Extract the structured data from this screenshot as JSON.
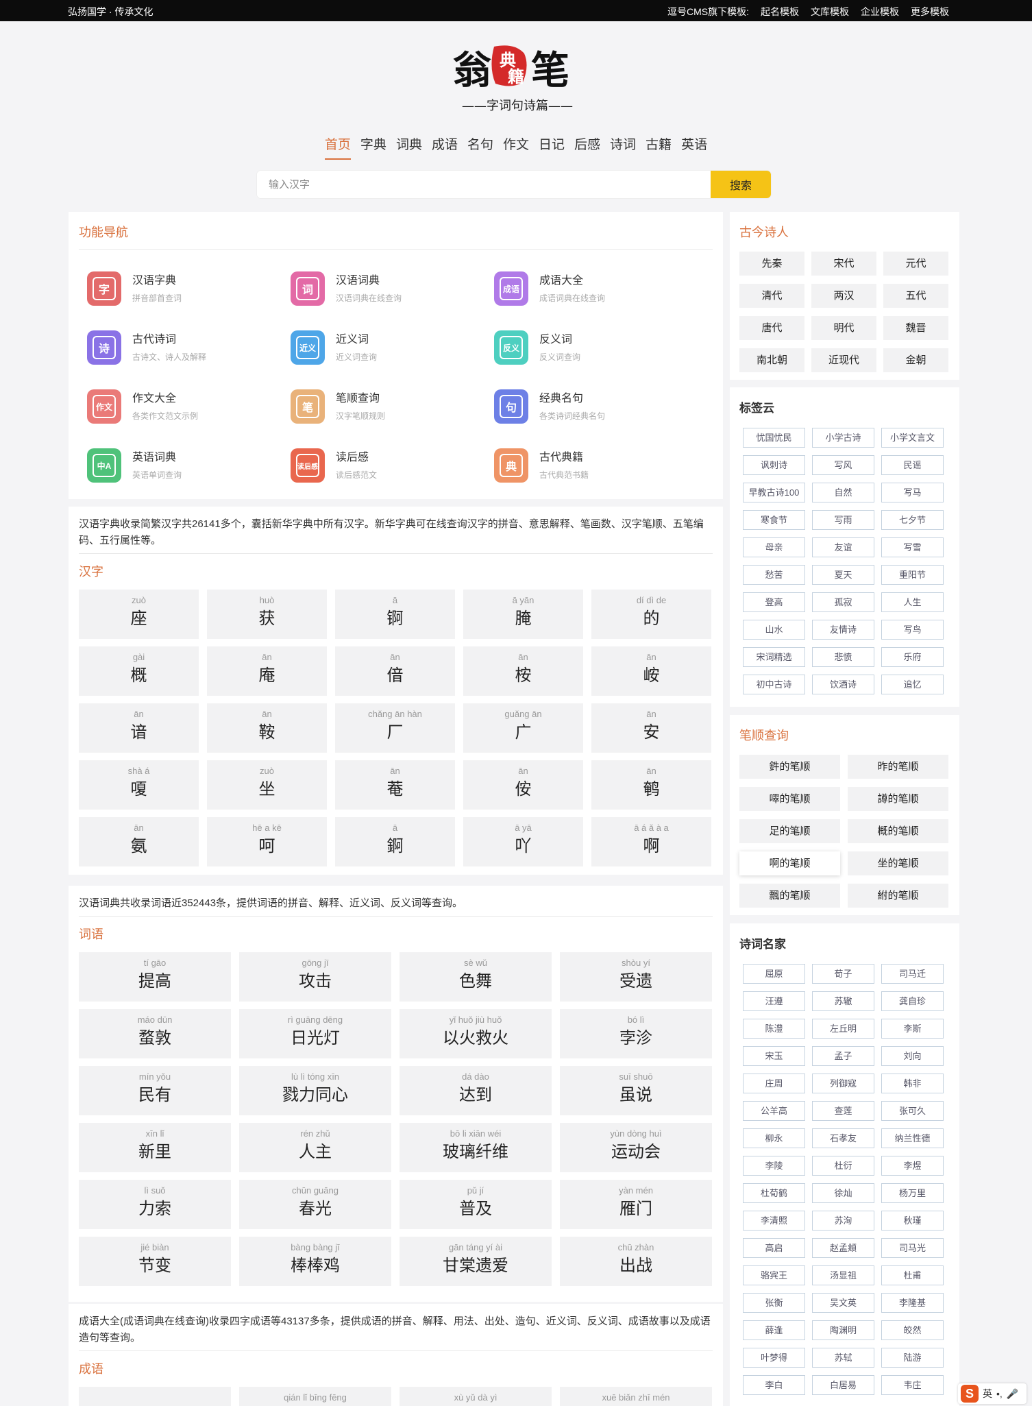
{
  "topbar": {
    "left": "弘扬国学 · 传承文化",
    "prefix": "逗号CMS旗下模板:",
    "links": [
      "起名模板",
      "文库模板",
      "企业模板",
      "更多模板"
    ]
  },
  "logo": {
    "chars": [
      "翁",
      "典",
      "籍",
      "笔"
    ],
    "tagline": "——字词句诗篇——"
  },
  "nav": [
    "首页",
    "字典",
    "词典",
    "成语",
    "名句",
    "作文",
    "日记",
    "后感",
    "诗词",
    "古籍",
    "英语"
  ],
  "search": {
    "placeholder": "输入汉字",
    "button": "搜索"
  },
  "func": {
    "title": "功能导航",
    "items": [
      {
        "icon": "字",
        "name": "汉语字典",
        "desc": "拼音部首查词",
        "color": "#e36a6a"
      },
      {
        "icon": "词",
        "name": "汉语词典",
        "desc": "汉语词典在线查询",
        "color": "#e36aa6"
      },
      {
        "icon": "成语",
        "name": "成语大全",
        "desc": "成语词典在线查询",
        "color": "#b07ae8"
      },
      {
        "icon": "诗",
        "name": "古代诗词",
        "desc": "古诗文、诗人及解释",
        "color": "#8a72e6"
      },
      {
        "icon": "近义",
        "name": "近义词",
        "desc": "近义词查询",
        "color": "#4ea6e8"
      },
      {
        "icon": "反义",
        "name": "反义词",
        "desc": "反义词查询",
        "color": "#4ecfc0"
      },
      {
        "icon": "作文",
        "name": "作文大全",
        "desc": "各类作文范文示例",
        "color": "#ea7a78"
      },
      {
        "icon": "笔",
        "name": "笔顺查询",
        "desc": "汉字笔顺规则",
        "color": "#e9b27a"
      },
      {
        "icon": "句",
        "name": "经典名句",
        "desc": "各类诗词经典名句",
        "color": "#6d80e6"
      },
      {
        "icon": "中A",
        "name": "英语词典",
        "desc": "英语单词查询",
        "color": "#4fc27a"
      },
      {
        "icon": "读后感",
        "name": "读后感",
        "desc": "读后感范文",
        "color": "#e9674e"
      },
      {
        "icon": "典",
        "name": "古代典籍",
        "desc": "古代典范书籍",
        "color": "#ef9466"
      }
    ]
  },
  "hanzi": {
    "desc": "汉语字典收录简繁汉字共26141多个，囊括新华字典中所有汉字。新华字典可在线查询汉字的拼音、意思解释、笔画数、汉字笔顺、五笔编码、五行属性等。",
    "title": "汉字",
    "items": [
      {
        "py": "zuò",
        "ch": "座"
      },
      {
        "py": "huò",
        "ch": "获"
      },
      {
        "py": "ā",
        "ch": "锕"
      },
      {
        "py": "ā yān",
        "ch": "腌"
      },
      {
        "py": "dí dì de",
        "ch": "的"
      },
      {
        "py": "gài",
        "ch": "概"
      },
      {
        "py": "ān",
        "ch": "庵"
      },
      {
        "py": "ān",
        "ch": "偣"
      },
      {
        "py": "ān",
        "ch": "桉"
      },
      {
        "py": "ān",
        "ch": "峖"
      },
      {
        "py": "ān",
        "ch": "谙"
      },
      {
        "py": "ān",
        "ch": "鞍"
      },
      {
        "py": "chǎng ān hàn",
        "ch": "厂"
      },
      {
        "py": "guǎng ān",
        "ch": "广"
      },
      {
        "py": "ān",
        "ch": "安"
      },
      {
        "py": "shà á",
        "ch": "嗄"
      },
      {
        "py": "zuò",
        "ch": "坐"
      },
      {
        "py": "ān",
        "ch": "菴"
      },
      {
        "py": "ān",
        "ch": "侒"
      },
      {
        "py": "ān",
        "ch": "鹌"
      },
      {
        "py": "ān",
        "ch": "氨"
      },
      {
        "py": "hē a kē",
        "ch": "呵"
      },
      {
        "py": "ā",
        "ch": "錒"
      },
      {
        "py": "ā yā",
        "ch": "吖"
      },
      {
        "py": "ā á ǎ à a",
        "ch": "啊"
      }
    ]
  },
  "ciyu": {
    "desc": "汉语词典共收录词语近352443条，提供词语的拼音、解释、近义词、反义词等查询。",
    "title": "词语",
    "items": [
      {
        "py": "tí gāo",
        "ch": "提高"
      },
      {
        "py": "gōng jī",
        "ch": "攻击"
      },
      {
        "py": "sè wǔ",
        "ch": "色舞"
      },
      {
        "py": "shòu yí",
        "ch": "受遗"
      },
      {
        "py": "máo dūn",
        "ch": "蝥敦"
      },
      {
        "py": "rì guāng dēng",
        "ch": "日光灯"
      },
      {
        "py": "yǐ huǒ jiù huǒ",
        "ch": "以火救火"
      },
      {
        "py": "bó lì",
        "ch": "孛沴"
      },
      {
        "py": "mín yǒu",
        "ch": "民有"
      },
      {
        "py": "lù lì tóng xīn",
        "ch": "戮力同心"
      },
      {
        "py": "dá dào",
        "ch": "达到"
      },
      {
        "py": "suī shuō",
        "ch": "虽说"
      },
      {
        "py": "xīn lǐ",
        "ch": "新里"
      },
      {
        "py": "rén zhǔ",
        "ch": "人主"
      },
      {
        "py": "bō li xiān wéi",
        "ch": "玻璃纤维"
      },
      {
        "py": "yùn dòng huì",
        "ch": "运动会"
      },
      {
        "py": "lì suǒ",
        "ch": "力索"
      },
      {
        "py": "chūn guāng",
        "ch": "春光"
      },
      {
        "py": "pǔ jí",
        "ch": "普及"
      },
      {
        "py": "yàn mén",
        "ch": "雁门"
      },
      {
        "py": "jié biàn",
        "ch": "节变"
      },
      {
        "py": "bàng bàng jī",
        "ch": "棒棒鸡"
      },
      {
        "py": "gān táng yí ài",
        "ch": "甘棠遗爱"
      },
      {
        "py": "chū zhàn",
        "ch": "出战"
      }
    ]
  },
  "chengyu": {
    "desc": "成语大全(成语词典在线查询)收录四字成语等43137多条，提供成语的拼音、解释、用法、出处、造句、近义词、反义词、成语故事以及成语造句等查询。",
    "title": "成语",
    "items": [
      {
        "py": "",
        "ch": ""
      },
      {
        "py": "qián lǐ bīng fēng",
        "ch": ""
      },
      {
        "py": "xù yǔ dà yì",
        "ch": ""
      },
      {
        "py": "xuē biǎn zhī mén",
        "ch": ""
      }
    ]
  },
  "poets": {
    "title": "古今诗人",
    "items": [
      "先秦",
      "宋代",
      "元代",
      "清代",
      "两汉",
      "五代",
      "唐代",
      "明代",
      "魏晋",
      "南北朝",
      "近现代",
      "金朝"
    ]
  },
  "tags": {
    "title": "标签云",
    "items": [
      "忧国忧民",
      "小学古诗",
      "小学文言文",
      "讽刺诗",
      "写风",
      "民谣",
      "早教古诗100",
      "自然",
      "写马",
      "寒食节",
      "写雨",
      "七夕节",
      "母亲",
      "友谊",
      "写雪",
      "愁苦",
      "夏天",
      "重阳节",
      "登高",
      "孤寂",
      "人生",
      "山水",
      "友情诗",
      "写鸟",
      "宋词精选",
      "悲愤",
      "乐府",
      "初中古诗",
      "饮酒诗",
      "追忆"
    ]
  },
  "strokes": {
    "title": "笔顺查询",
    "items": [
      "鈝的笔顺",
      "昨的笔顺",
      "噿的笔顺",
      "譐的笔顺",
      "足的笔顺",
      "概的笔顺",
      "啊的笔顺",
      "坐的笔顺",
      "飄的笔顺",
      "紨的笔顺"
    ]
  },
  "famous": {
    "title": "诗词名家",
    "items": [
      "屈原",
      "荀子",
      "司马迁",
      "汪遵",
      "苏辙",
      "龚自珍",
      "陈澧",
      "左丘明",
      "李斯",
      "宋玉",
      "孟子",
      "刘向",
      "庄周",
      "列御寇",
      "韩非",
      "公羊高",
      "查莲",
      "张可久",
      "柳永",
      "石孝友",
      "纳兰性德",
      "李陵",
      "杜衍",
      "李煜",
      "杜荀鹤",
      "徐灿",
      "杨万里",
      "李清照",
      "苏洵",
      "秋瑾",
      "高启",
      "赵孟頫",
      "司马光",
      "骆宾王",
      "汤显祖",
      "杜甫",
      "张衡",
      "吴文英",
      "李隆基",
      "薛逢",
      "陶渊明",
      "皎然",
      "叶梦得",
      "苏轼",
      "陆游",
      "李白",
      "白居易",
      "韦庄"
    ]
  },
  "ime": {
    "label": "英"
  }
}
